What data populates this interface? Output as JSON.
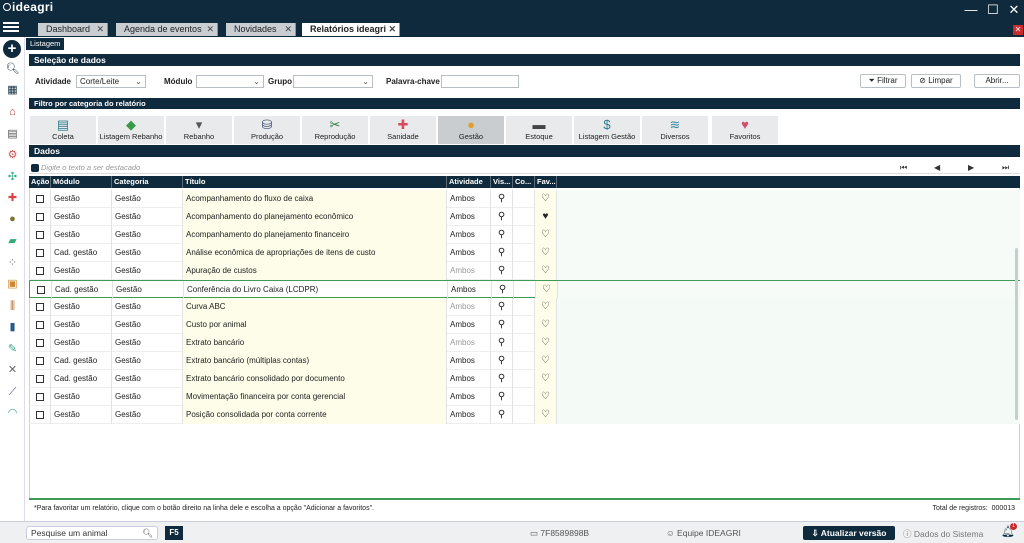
{
  "app": {
    "logo": "ideagri"
  },
  "tabs": [
    {
      "label": "Dashboard"
    },
    {
      "label": "Agenda de eventos"
    },
    {
      "label": "Novidades"
    },
    {
      "label": "Relatórios ideagri"
    }
  ],
  "listagem_tab": "Listagem",
  "selecao": {
    "title": "Seleção de dados",
    "atividade_label": "Atividade",
    "atividade_value": "Corte/Leite",
    "modulo_label": "Módulo",
    "modulo_value": "",
    "grupo_label": "Grupo",
    "grupo_value": "",
    "palavra_label": "Palavra-chave",
    "palavra_value": "",
    "filtrar": "Filtrar",
    "limpar": "Limpar",
    "abrir": "Abrir..."
  },
  "filtro": {
    "title": "Filtro por categoria do relatório",
    "categories": [
      {
        "label": "Coleta",
        "icon": "clipboard-icon",
        "color": "#2e7d8a"
      },
      {
        "label": "Listagem Rebanho",
        "icon": "cow-icon",
        "color": "#3a9a4a"
      },
      {
        "label": "Rebanho",
        "icon": "cow-head-icon",
        "color": "#555"
      },
      {
        "label": "Produção",
        "icon": "milk-can-icon",
        "color": "#3d4c70"
      },
      {
        "label": "Reprodução",
        "icon": "syringe-icon",
        "color": "#2a7a3a"
      },
      {
        "label": "Sanidade",
        "icon": "cross-icon",
        "color": "#d84b5a"
      },
      {
        "label": "Gestão",
        "icon": "coin-icon",
        "color": "#e0a030"
      },
      {
        "label": "Estoque",
        "icon": "truck-icon",
        "color": "#444"
      },
      {
        "label": "Listagem Gestão",
        "icon": "dollar-doc-icon",
        "color": "#2a7a8a"
      },
      {
        "label": "Diversos",
        "icon": "misc-icon",
        "color": "#3a8aa0"
      },
      {
        "label": "Favoritos",
        "icon": "heart-icon",
        "color": "#d84b6a"
      }
    ]
  },
  "dados": {
    "title": "Dados",
    "search_placeholder": "Digite o texto a ser destacado"
  },
  "table": {
    "headers": [
      "Ação",
      "Módulo",
      "Categoria",
      "Título",
      "Atividade",
      "Vis...",
      "Co...",
      "Fav..."
    ],
    "rows": [
      {
        "modulo": "Gestão",
        "categoria": "Gestão",
        "titulo": "Acompanhamento do fluxo de caixa",
        "atividade": "Ambos",
        "fav": false
      },
      {
        "modulo": "Gestão",
        "categoria": "Gestão",
        "titulo": "Acompanhamento do planejamento econômico",
        "atividade": "Ambos",
        "fav": true
      },
      {
        "modulo": "Gestão",
        "categoria": "Gestão",
        "titulo": "Acompanhamento do planejamento financeiro",
        "atividade": "Ambos",
        "fav": false
      },
      {
        "modulo": "Cad. gestão",
        "categoria": "Gestão",
        "titulo": "Análise econômica de apropriações de itens de custo",
        "atividade": "Ambos",
        "fav": false
      },
      {
        "modulo": "Gestão",
        "categoria": "Gestão",
        "titulo": "Apuração de custos",
        "atividade": "Ambos",
        "fav": false
      },
      {
        "modulo": "Cad. gestão",
        "categoria": "Gestão",
        "titulo": "Conferência do Livro Caixa (LCDPR)",
        "atividade": "Ambos",
        "fav": false
      },
      {
        "modulo": "Gestão",
        "categoria": "Gestão",
        "titulo": "Curva ABC",
        "atividade": "Ambos",
        "fav": false
      },
      {
        "modulo": "Gestão",
        "categoria": "Gestão",
        "titulo": "Custo por animal",
        "atividade": "Ambos",
        "fav": false
      },
      {
        "modulo": "Gestão",
        "categoria": "Gestão",
        "titulo": "Extrato bancário",
        "atividade": "Ambos",
        "fav": false
      },
      {
        "modulo": "Cad. gestão",
        "categoria": "Gestão",
        "titulo": "Extrato bancário (múltiplas contas)",
        "atividade": "Ambos",
        "fav": false
      },
      {
        "modulo": "Cad. gestão",
        "categoria": "Gestão",
        "titulo": "Extrato bancário consolidado por documento",
        "atividade": "Ambos",
        "fav": false
      },
      {
        "modulo": "Gestão",
        "categoria": "Gestão",
        "titulo": "Movimentação financeira por conta gerencial",
        "atividade": "Ambos",
        "fav": false
      },
      {
        "modulo": "Gestão",
        "categoria": "Gestão",
        "titulo": "Posição consolidada por conta corrente",
        "atividade": "Ambos",
        "fav": false
      }
    ]
  },
  "footer": {
    "hint": "*Para favoritar um relatório, clique com o botão direito na linha dele e escolha a opção \"Adicionar a favoritos\".",
    "total_label": "Total de registros:",
    "total_value": "000013"
  },
  "status": {
    "search_placeholder": "Pesquise um animal",
    "f5": "F5",
    "machine": "7F8589898B",
    "team": "Equipe IDEAGRI",
    "update": "Atualizar versão",
    "sistema": "Dados do Sistema",
    "notif_count": "1"
  }
}
